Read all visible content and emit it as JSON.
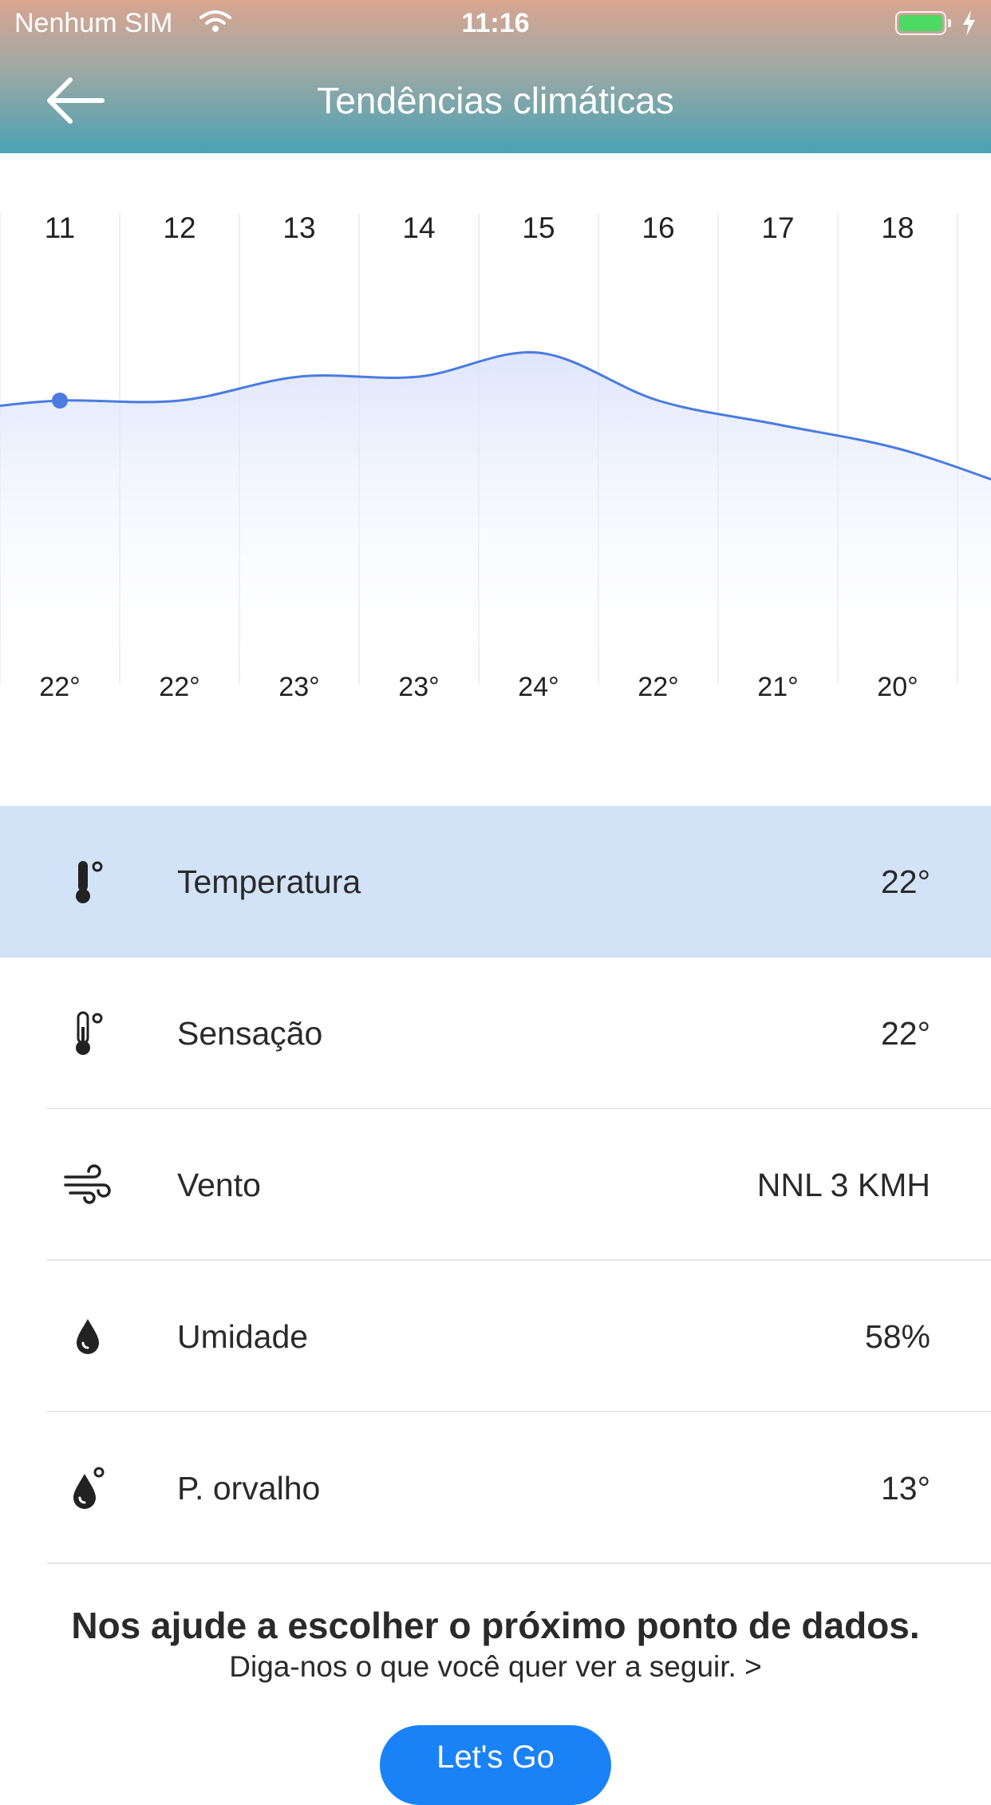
{
  "status_bar": {
    "carrier": "Nenhum SIM",
    "time": "11:16"
  },
  "header": {
    "title": "Tendências climáticas"
  },
  "colors": {
    "accent": "#4a7be0",
    "selected_row": "#d2e3f7",
    "button": "#1a82f7",
    "battery": "#4cd964"
  },
  "chart_data": {
    "type": "area",
    "categories": [
      "11",
      "12",
      "13",
      "14",
      "15",
      "16",
      "17",
      "18"
    ],
    "values": [
      22,
      22,
      23,
      23,
      24,
      22,
      21,
      20
    ],
    "value_labels": [
      "22°",
      "22°",
      "23°",
      "23°",
      "24°",
      "22°",
      "21°",
      "20°"
    ],
    "selected_index": 0,
    "grid": true
  },
  "details": [
    {
      "icon": "thermometer-icon",
      "label": "Temperatura",
      "value": "22°",
      "selected": true
    },
    {
      "icon": "thermometer-outline-icon",
      "label": "Sensação",
      "value": "22°",
      "selected": false
    },
    {
      "icon": "wind-icon",
      "label": "Vento",
      "value": "NNL 3 KMH",
      "selected": false
    },
    {
      "icon": "droplet-icon",
      "label": "Umidade",
      "value": "58%",
      "selected": false
    },
    {
      "icon": "dew-point-icon",
      "label": "P. orvalho",
      "value": "13°",
      "selected": false
    }
  ],
  "promo": {
    "title": "Nos ajude a escolher o próximo ponto de dados.",
    "subtitle": "Diga-nos o que você quer ver a seguir. >",
    "button_label": "Let's Go"
  }
}
